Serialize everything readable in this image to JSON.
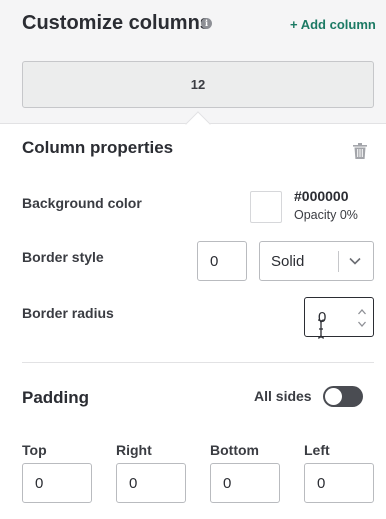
{
  "header": {
    "title": "Customize columns",
    "info_icon": "info-icon",
    "add_column_label": "+ Add column"
  },
  "column_preview": {
    "label": "12"
  },
  "column_properties": {
    "title": "Column properties",
    "delete_icon": "trash-icon",
    "background_color": {
      "label": "Background color",
      "hex": "#000000",
      "opacity": "Opacity 0%",
      "swatch_color": "#ffffff"
    },
    "border_style": {
      "label": "Border style",
      "width_value": "0",
      "style_value": "Solid",
      "chevron_icon": "chevron-down-icon"
    },
    "border_radius": {
      "label": "Border radius",
      "value": "0"
    }
  },
  "padding": {
    "title": "Padding",
    "all_sides_label": "All sides",
    "all_sides_on": false,
    "fields": [
      {
        "label": "Top",
        "value": "0"
      },
      {
        "label": "Right",
        "value": "0"
      },
      {
        "label": "Bottom",
        "value": "0"
      },
      {
        "label": "Left",
        "value": "0"
      }
    ]
  },
  "colors": {
    "accent": "#1c7a64",
    "toggle_off": "#4a4c52"
  }
}
